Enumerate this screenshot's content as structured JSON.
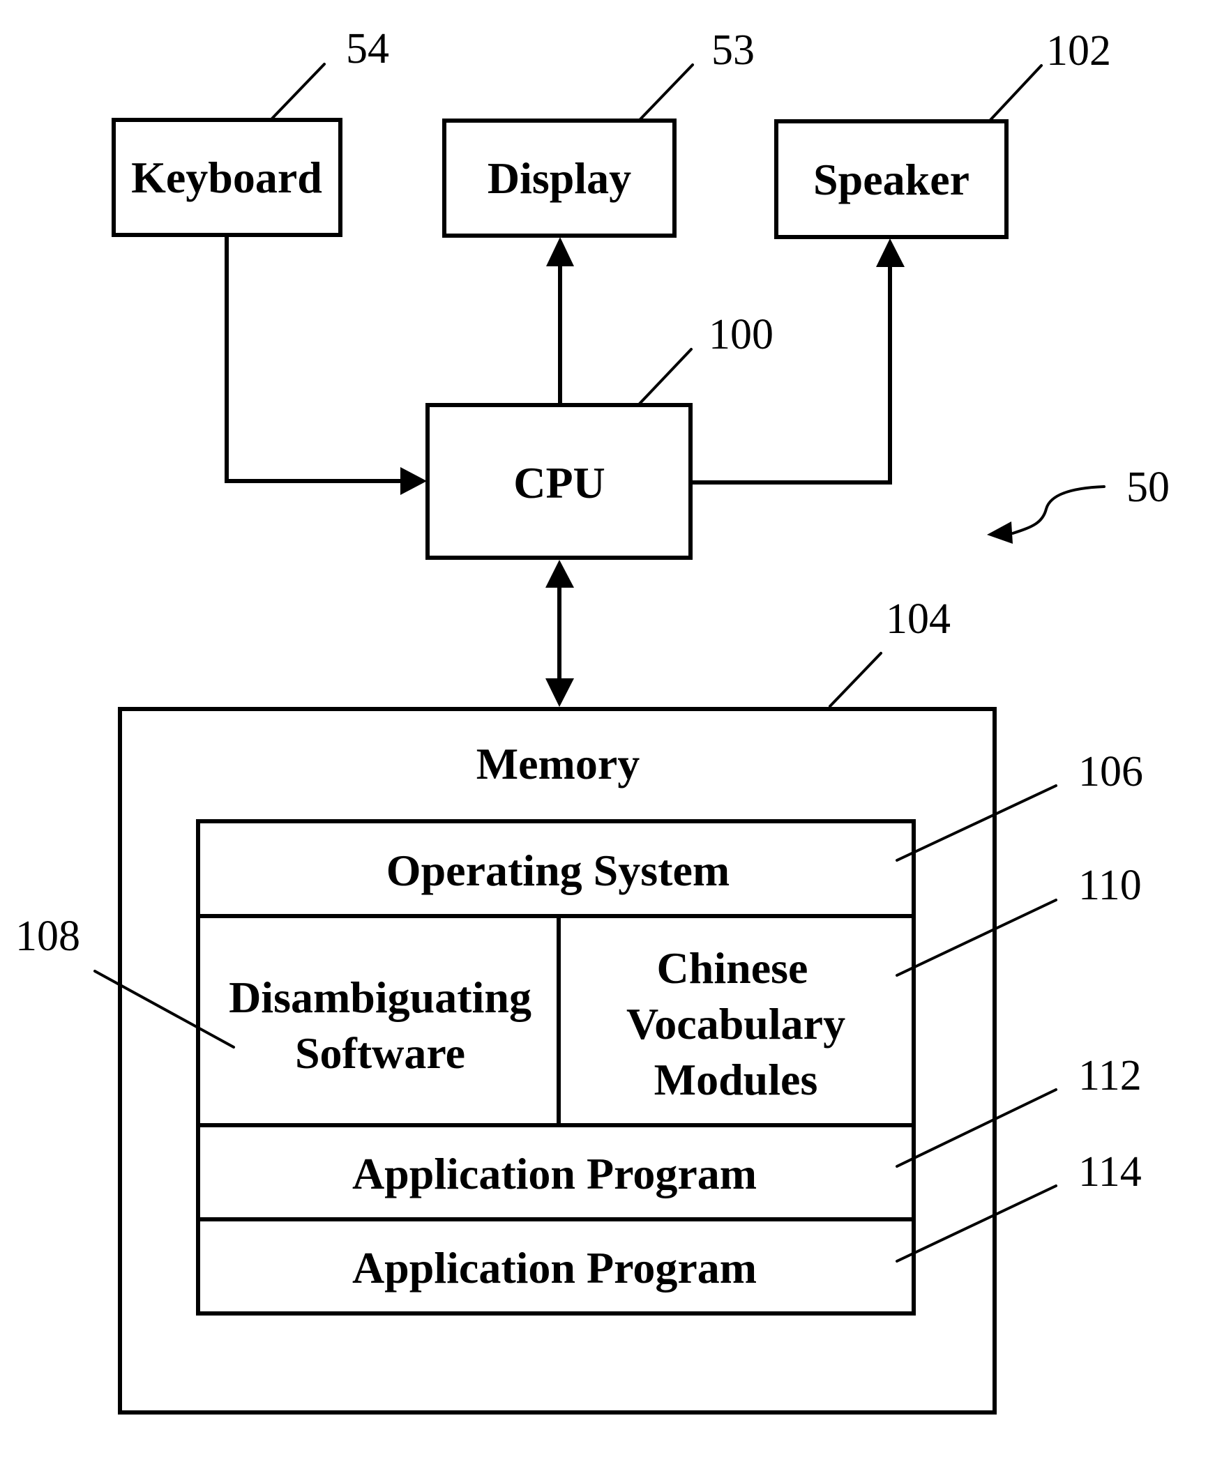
{
  "figure": {
    "reference": "50",
    "components": {
      "keyboard": {
        "label": "Keyboard",
        "ref": "54"
      },
      "display": {
        "label": "Display",
        "ref": "53"
      },
      "speaker": {
        "label": "Speaker",
        "ref": "102"
      },
      "cpu": {
        "label": "CPU",
        "ref": "100"
      },
      "memory": {
        "label": "Memory",
        "ref": "104",
        "contents": {
          "operating_system": {
            "label": "Operating System",
            "ref": "106"
          },
          "disambiguating_software": {
            "lines": [
              "Disambiguating",
              "Software"
            ],
            "ref": "108"
          },
          "chinese_vocabulary_modules": {
            "lines": [
              "Chinese",
              "Vocabulary",
              "Modules"
            ],
            "ref": "110"
          },
          "application_program_1": {
            "label": "Application Program",
            "ref": "112"
          },
          "application_program_2": {
            "label": "Application Program",
            "ref": "114"
          }
        }
      }
    },
    "connections": [
      {
        "from": "Keyboard",
        "to": "CPU",
        "direction": "one-way"
      },
      {
        "from": "CPU",
        "to": "Display",
        "direction": "one-way"
      },
      {
        "from": "CPU",
        "to": "Speaker",
        "direction": "one-way"
      },
      {
        "from": "CPU",
        "to": "Memory",
        "direction": "two-way"
      }
    ]
  }
}
